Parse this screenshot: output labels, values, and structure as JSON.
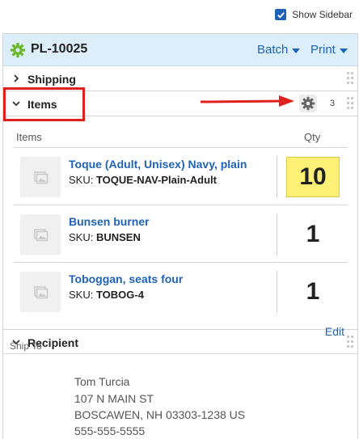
{
  "topbar": {
    "show_sidebar_label": "Show Sidebar",
    "show_sidebar_checked": true
  },
  "header": {
    "title": "PL-10025",
    "batch_label": "Batch",
    "print_label": "Print"
  },
  "sections": {
    "shipping": "Shipping",
    "items": "Items",
    "recipient": "Recipient"
  },
  "items_count": "3",
  "columns": {
    "items": "Items",
    "qty": "Qty"
  },
  "items": [
    {
      "name": "Toque (Adult, Unisex) Navy, plain",
      "sku_label": "SKU:",
      "sku": "TOQUE-NAV-Plain-Adult",
      "qty": "10"
    },
    {
      "name": "Bunsen burner",
      "sku_label": "SKU:",
      "sku": "BUNSEN",
      "qty": "1"
    },
    {
      "name": "Toboggan, seats four",
      "sku_label": "SKU:",
      "sku": "TOBOG-4",
      "qty": "1"
    }
  ],
  "recipient": {
    "edit_label": "Edit",
    "ship_to_label": "Ship To",
    "name": "Tom Turcia",
    "address_line1": "107 N MAIN ST",
    "address_line2": "BOSCAWEN, NH 03303-1238 US",
    "phone": "555-555-5555"
  },
  "colors": {
    "accent": "#1f63b6",
    "header_bg": "#dbeefa",
    "highlight": "#e0201c",
    "qty_highlight": "#fff176"
  }
}
